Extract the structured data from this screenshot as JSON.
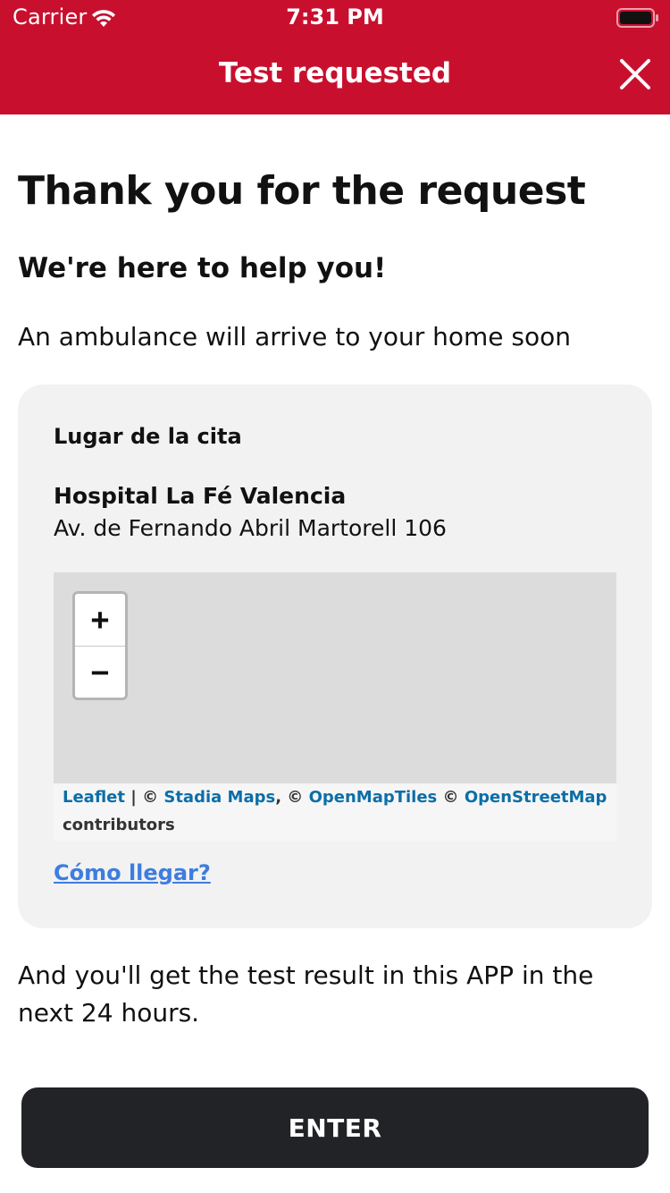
{
  "status_bar": {
    "carrier": "Carrier",
    "time": "7:31 PM",
    "wifi_icon": "wifi-icon",
    "battery_icon": "battery-icon"
  },
  "header": {
    "title": "Test requested",
    "close_icon": "close-icon",
    "background_color": "#c8102e"
  },
  "main": {
    "heading": "Thank you for the request",
    "subheading": "We're here to help you!",
    "message": "An ambulance will arrive to your home soon",
    "footer_text": "And you'll get the test result in this APP in the next 24 hours."
  },
  "appointment": {
    "label": "Lugar de la cita",
    "place_name": "Hospital La Fé Valencia",
    "address": "Av. de Fernando Abril Martorell 106",
    "directions_link": "Cómo llegar?"
  },
  "map": {
    "zoom_in_label": "+",
    "zoom_out_label": "−",
    "attribution": {
      "leaflet": "Leaflet",
      "sep1": " | © ",
      "stadia": "Stadia Maps",
      "sep2": ", © ",
      "openmaptiles": "OpenMapTiles",
      "sep3": " © ",
      "osm": "OpenStreetMap",
      "contributors": "contributors"
    },
    "link_color": "#0b6ea8"
  },
  "actions": {
    "enter_label": "ENTER",
    "enter_color": "#222326"
  }
}
